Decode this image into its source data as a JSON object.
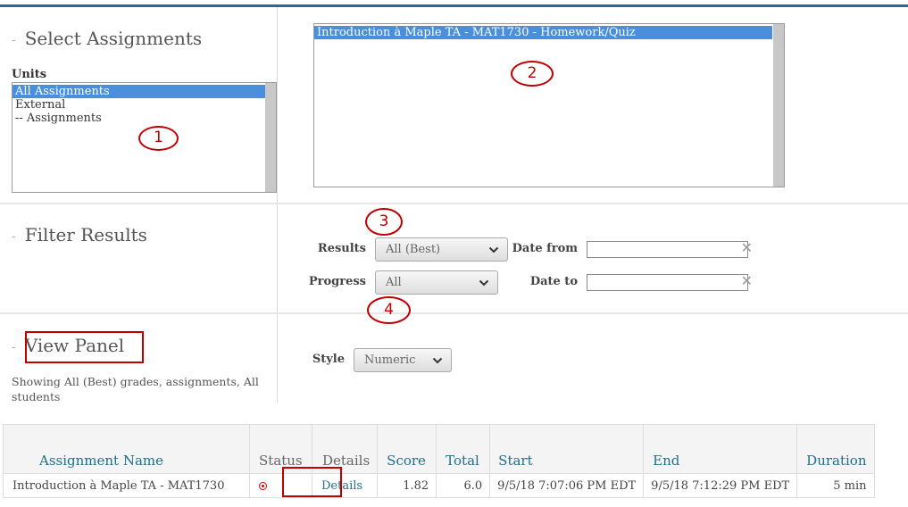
{
  "sections": {
    "select_assignments": "Select Assignments",
    "filter_results": "Filter Results",
    "view_panel": "View Panel"
  },
  "units": {
    "label": "Units",
    "options": [
      "All Assignments",
      "External",
      "-- Assignments"
    ],
    "selected": "All Assignments"
  },
  "assignments": {
    "options": [
      "Introduction à Maple TA - MAT1730 - Homework/Quiz"
    ],
    "selected": "Introduction à Maple TA - MAT1730 - Homework/Quiz"
  },
  "annotations": [
    "1",
    "2",
    "3",
    "4"
  ],
  "filters": {
    "results_label": "Results",
    "results_value": "All (Best)",
    "progress_label": "Progress",
    "progress_value": "All",
    "date_from_label": "Date from",
    "date_to_label": "Date to",
    "date_from_value": "",
    "date_to_value": "",
    "clear_glyph": "✕"
  },
  "view": {
    "style_label": "Style",
    "style_value": "Numeric",
    "showing_text": "Showing All (Best) grades, assignments, All students"
  },
  "table": {
    "headers": [
      "Assignment Name",
      "Status",
      "Details",
      "Score",
      "Total",
      "Start",
      "End",
      "Duration"
    ],
    "rows": [
      {
        "name": "Introduction à Maple TA - MAT1730",
        "status": "status-icon",
        "details": "Details",
        "score": "1.82",
        "total": "6.0",
        "start": "9/5/18 7:07:06 PM EDT",
        "end": "9/5/18 7:12:29 PM EDT",
        "duration": "5 min"
      }
    ]
  },
  "colors": {
    "accent": "#1d6f8c",
    "selection": "#4a8fdb",
    "annotation_red": "#c00000"
  }
}
